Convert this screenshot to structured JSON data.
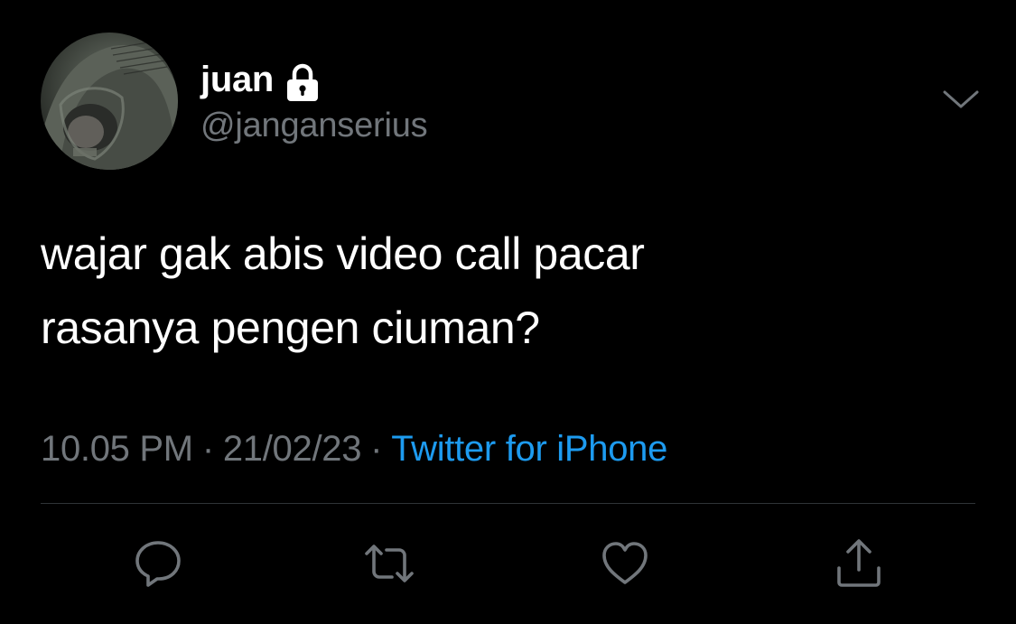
{
  "user": {
    "display_name": "juan",
    "handle": "@janganserius",
    "avatar_icon": "avatar-hooded-person",
    "protected_icon": "lock-icon"
  },
  "tweet": {
    "line1": "wajar gak abis video call pacar",
    "line2": "rasanya pengen ciuman?"
  },
  "meta": {
    "time": "10.05 PM",
    "separator": "·",
    "date": "21/02/23",
    "source": "Twitter for iPhone"
  },
  "actions": {
    "reply_icon": "reply-icon",
    "retweet_icon": "retweet-icon",
    "like_icon": "heart-icon",
    "share_icon": "share-icon",
    "more_icon": "chevron-down-icon"
  },
  "colors": {
    "background": "#000000",
    "text_primary": "#ffffff",
    "text_secondary": "#71767b",
    "accent": "#1d9bf0",
    "divider": "#2f3336"
  }
}
